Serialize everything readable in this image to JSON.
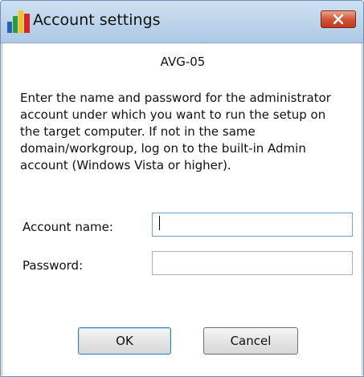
{
  "window": {
    "title": "Account settings",
    "icon": "avg-logo-icon",
    "close_icon": "close-x-icon"
  },
  "dialog": {
    "computer_name": "AVG-05",
    "description": "Enter the name and password for the administrator account under which you want to run the setup on the target computer. If not in the same domain/workgroup, log on to the built-in Admin account (Windows Vista or higher).",
    "account_label": "Account name:",
    "account_value": "",
    "password_label": "Password:",
    "password_value": ""
  },
  "buttons": {
    "ok": "OK",
    "cancel": "Cancel"
  },
  "colors": {
    "titlebar": "#bcd3ea",
    "close_button": "#d4553a",
    "logo_red": "#d6262b",
    "logo_yellow": "#f5c21b",
    "logo_green": "#2e9b3f",
    "logo_blue": "#2563b0"
  }
}
